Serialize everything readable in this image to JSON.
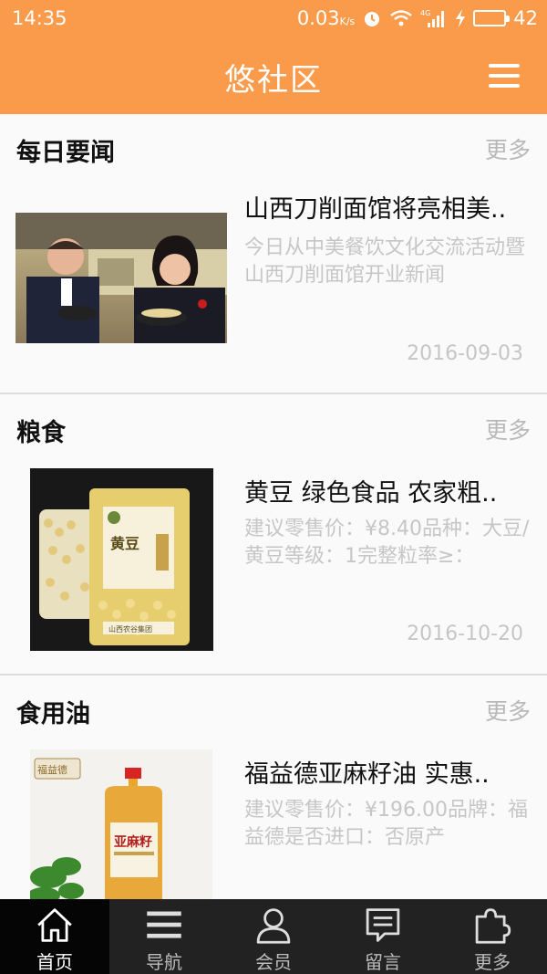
{
  "status": {
    "time": "14:35",
    "speed": "0.03",
    "speed_unit": "K/s",
    "network": "4G",
    "battery": "42",
    "battery_level": 0.42
  },
  "header": {
    "title": "悠社区"
  },
  "sections": [
    {
      "title": "每日要闻",
      "more": "更多",
      "item": {
        "title": "山西刀削面馆将亮相美..",
        "desc": "今日从中美餐饮文化交流活动暨山西刀削面馆开业新闻",
        "date": "2016-09-03"
      }
    },
    {
      "title": "粮食",
      "more": "更多",
      "item": {
        "title": "黄豆 绿色食品 农家粗..",
        "desc": "建议零售价：¥8.40品种：大豆/黄豆等级：1完整粒率≥：",
        "date": "2016-10-20"
      }
    },
    {
      "title": "食用油",
      "more": "更多",
      "item": {
        "title": "福益德亚麻籽油 实惠..",
        "desc": "建议零售价：¥196.00品牌：福益德是否进口：否原产"
      }
    }
  ],
  "nav": [
    {
      "label": "首页",
      "icon": "home-icon",
      "active": true
    },
    {
      "label": "导航",
      "icon": "menu-icon",
      "active": false
    },
    {
      "label": "会员",
      "icon": "user-icon",
      "active": false
    },
    {
      "label": "留言",
      "icon": "message-icon",
      "active": false
    },
    {
      "label": "更多",
      "icon": "puzzle-icon",
      "active": false
    }
  ],
  "colors": {
    "accent": "#f99b4b",
    "nav_bg": "#222222",
    "muted_text": "#c6c6c6"
  },
  "product_labels": {
    "soy_bag": "黄豆",
    "soy_brand": "山西农谷集团",
    "oil_brand": "福益德",
    "oil_label": "亚麻籽"
  }
}
